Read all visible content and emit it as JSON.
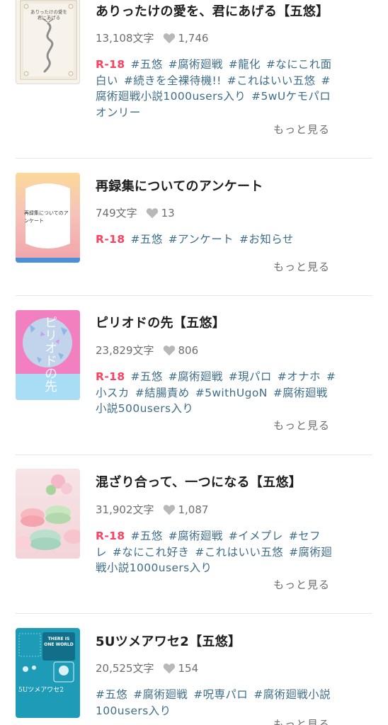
{
  "items": [
    {
      "title": "ありったけの愛を、君にあげる【五悠】",
      "chars": "13,108文字",
      "likes": "1,746",
      "r18": "R-18",
      "tags": [
        "#五悠",
        "#腐術廻戦",
        "#龍化",
        "#なにこれ面白い",
        "#続きを全裸待機!!",
        "#これはいい五悠",
        "#腐術廻戦小説1000users入り",
        "#5wUケモパロオンリー"
      ],
      "more": "もっと見る",
      "cover_text": "ありったけの愛を君にあげる"
    },
    {
      "title": "再録集についてのアンケート",
      "chars": "749文字",
      "likes": "13",
      "r18": "R-18",
      "tags": [
        "#五悠",
        "#アンケート",
        "#お知らせ"
      ],
      "more": "もっと見る",
      "cover_text": "再録集についてのアンケート"
    },
    {
      "title": "ピリオドの先【五悠】",
      "chars": "23,829文字",
      "likes": "806",
      "r18": "R-18",
      "tags": [
        "#五悠",
        "#腐術廻戦",
        "#現パロ",
        "#オナホ",
        "#小スカ",
        "#結腸責め",
        "#5withUgoN",
        "#腐術廻戦小説500users入り"
      ],
      "more": "もっと見る",
      "cover_text": "ピリオドの先"
    },
    {
      "title": "混ざり合って、一つになる【五悠】",
      "chars": "31,902文字",
      "likes": "1,087",
      "r18": "R-18",
      "tags": [
        "#五悠",
        "#腐術廻戦",
        "#イメプレ",
        "#セフレ",
        "#なにこれ好き",
        "#これはいい五悠",
        "#腐術廻戦小説1000users入り"
      ],
      "more": "もっと見る"
    },
    {
      "title": "5Uツメアワセ2【五悠】",
      "chars": "20,525文字",
      "likes": "154",
      "r18": "",
      "tags": [
        "#五悠",
        "#腐術廻戦",
        "#呪専パロ",
        "#腐術廻戦小説100users入り"
      ],
      "more": "もっと見る",
      "cover_text": "5Uツメアワセ2",
      "cover_badge": "THERE IS ONE WORLD"
    }
  ],
  "colors": {
    "tag": "#3e6d8a",
    "r18": "#ff4060",
    "meta": "#6e6e6e",
    "heart": "#b8b8b8"
  }
}
